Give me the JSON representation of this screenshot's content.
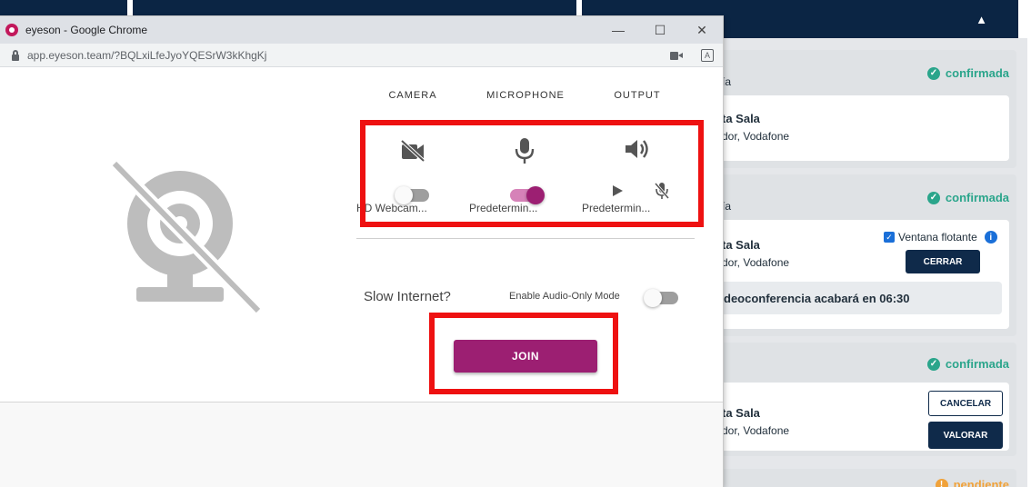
{
  "browser": {
    "window_title": "eyeson - Google Chrome",
    "url": "app.eyeson.team/?BQLxiLfeJyoYQESrW3kKhgKj",
    "minimize": "—",
    "maximize": "☐",
    "close": "✕"
  },
  "devices": {
    "camera": {
      "label": "CAMERA",
      "name": "HD Webcam...",
      "enabled": false
    },
    "microphone": {
      "label": "MICROPHONE",
      "name": "Predetermin...",
      "enabled": true
    },
    "output": {
      "label": "OUTPUT",
      "name": "Predetermin..."
    }
  },
  "settings": {
    "slow_internet_label": "Slow Internet?",
    "audio_only_label": "Enable Audio-Only Mode",
    "audio_only_enabled": false
  },
  "join_button": "JOIN",
  "background": {
    "cards": [
      {
        "status": "confirmada",
        "frag_top": "ía",
        "room": "ta Sala",
        "provider": "dor, Vodafone"
      },
      {
        "status": "confirmada",
        "frag_top": "ía",
        "room": "ta Sala",
        "provider": "dor, Vodafone",
        "floating_label": "Ventana flotante",
        "close_button": "CERRAR",
        "countdown": "deoconferencia acabará en 06:30"
      },
      {
        "status": "confirmada",
        "room": "ta Sala",
        "provider": "dor, Vodafone",
        "cancel_button": "CANCELAR",
        "rate_button": "VALORAR"
      },
      {
        "status": "pendiente"
      }
    ]
  },
  "colors": {
    "accent": "#9c1f72",
    "highlight": "#ee1111",
    "navy": "#0b2544",
    "confirmed": "#2aa58b",
    "pending": "#f0a23a"
  }
}
